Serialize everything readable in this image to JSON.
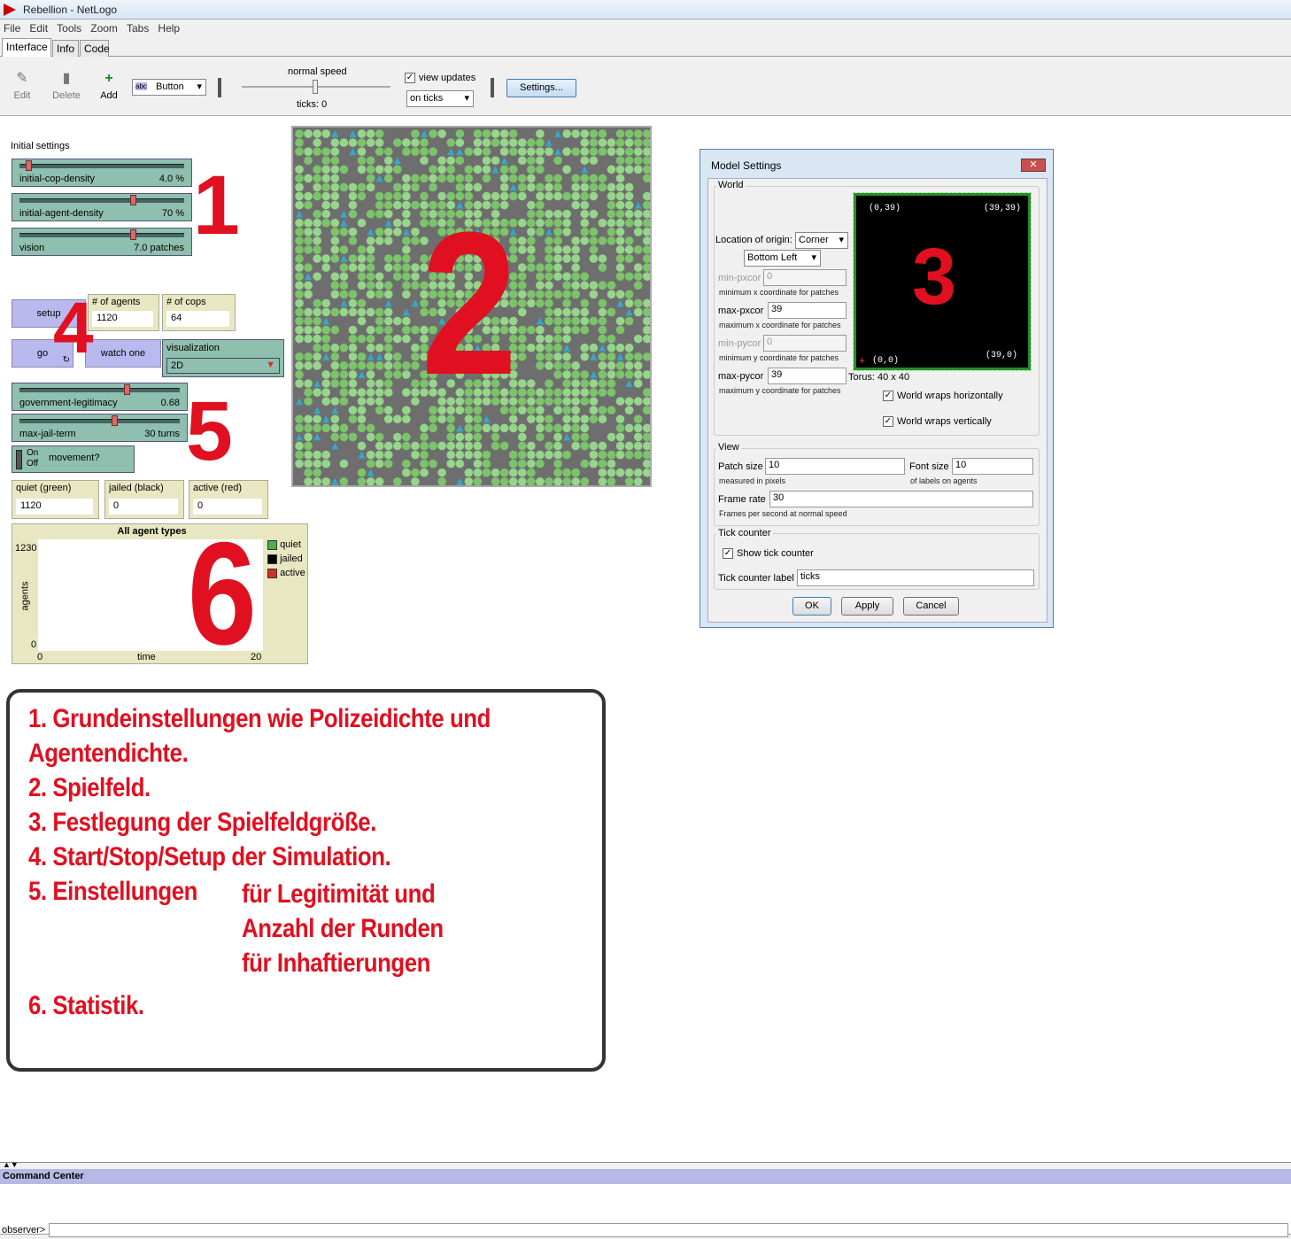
{
  "window": {
    "title": "Rebellion - NetLogo"
  },
  "menu": [
    "File",
    "Edit",
    "Tools",
    "Zoom",
    "Tabs",
    "Help"
  ],
  "tabs": [
    "Interface",
    "Info",
    "Code"
  ],
  "toolbar": {
    "edit": "Edit",
    "delete": "Delete",
    "add": "Add",
    "widget_type": "Button",
    "speed_label": "normal speed",
    "ticks": "ticks: 0",
    "view_updates": "view updates",
    "update_mode": "on ticks",
    "settings": "Settings..."
  },
  "interface": {
    "section_label": "Initial settings",
    "sliders": {
      "cop": {
        "name": "initial-cop-density",
        "value": "4.0 %",
        "fraction": 0.04
      },
      "agent": {
        "name": "initial-agent-density",
        "value": "70 %",
        "fraction": 0.7
      },
      "vision": {
        "name": "vision",
        "value": "7.0 patches",
        "fraction": 0.7
      },
      "legit": {
        "name": "government-legitimacy",
        "value": "0.68",
        "fraction": 0.68
      },
      "jail": {
        "name": "max-jail-term",
        "value": "30 turns",
        "fraction": 0.6
      }
    },
    "buttons": {
      "setup": "setup",
      "go": "go",
      "watch": "watch one"
    },
    "monitors": {
      "agents": {
        "label": "# of agents",
        "value": "1120"
      },
      "cops": {
        "label": "# of cops",
        "value": "64"
      },
      "quiet": {
        "label": "quiet (green)",
        "value": "1120"
      },
      "jailed": {
        "label": "jailed (black)",
        "value": "0"
      },
      "active": {
        "label": "active (red)",
        "value": "0"
      }
    },
    "chooser": {
      "label": "visualization",
      "value": "2D"
    },
    "switch": {
      "on": "On",
      "off": "Off",
      "label": "movement?"
    },
    "plot": {
      "title": "All agent types",
      "ymax": "1230",
      "ymin": "0",
      "xmin": "0",
      "xmax": "20",
      "xlabel": "time",
      "ylabel": "agents",
      "legend": [
        "quiet",
        "jailed",
        "active"
      ],
      "legend_colors": [
        "#4caf50",
        "#000000",
        "#d32f2f"
      ]
    }
  },
  "markers": [
    "1",
    "2",
    "3",
    "4",
    "5",
    "6"
  ],
  "dialog": {
    "title": "Model Settings",
    "close": "✕",
    "world": "World",
    "origin_label": "Location of origin:",
    "origin": "Corner",
    "origin_pos": "Bottom Left",
    "min_pxcor": {
      "label": "min-pxcor",
      "value": "0",
      "hint": "minimum x coordinate for patches"
    },
    "max_pxcor": {
      "label": "max-pxcor",
      "value": "39",
      "hint": "maximum x coordinate for patches"
    },
    "min_pycor": {
      "label": "min-pycor",
      "value": "0",
      "hint": "minimum y coordinate for patches"
    },
    "max_pycor": {
      "label": "max-pycor",
      "value": "39",
      "hint": "maximum y coordinate for patches"
    },
    "corners": {
      "tl": "(0,39)",
      "tr": "(39,39)",
      "bl": "(0,0)",
      "br": "(39,0)"
    },
    "torus": "Torus: 40 x 40",
    "wrap_h": "World wraps horizontally",
    "wrap_v": "World wraps vertically",
    "view": "View",
    "patch_size": {
      "label": "Patch size",
      "value": "10",
      "hint": "measured in pixels"
    },
    "font_size": {
      "label": "Font size",
      "value": "10",
      "hint": "of labels on agents"
    },
    "frame_rate": {
      "label": "Frame rate",
      "value": "30",
      "hint": "Frames per second at normal speed"
    },
    "tick": "Tick counter",
    "show_tick": "Show tick counter",
    "tick_label": {
      "label": "Tick counter label",
      "value": "ticks"
    },
    "ok": "OK",
    "apply": "Apply",
    "cancel": "Cancel"
  },
  "notes": {
    "l1": "1. Grundeinstellungen wie Polizeidichte und",
    "l1b": "Agentendichte.",
    "l2": "2. Spielfeld.",
    "l3": "3. Festlegung der Spielfeldgröße.",
    "l4": "4. Start/Stop/Setup der Simulation.",
    "l5": "5. Einstellungen",
    "l5b": "für Legitimität und",
    "l5c": "Anzahl der Runden",
    "l5d": "für Inhaftierungen",
    "l6": "6. Statistik."
  },
  "command_center": {
    "title": "Command Center",
    "prompt": "observer>"
  }
}
